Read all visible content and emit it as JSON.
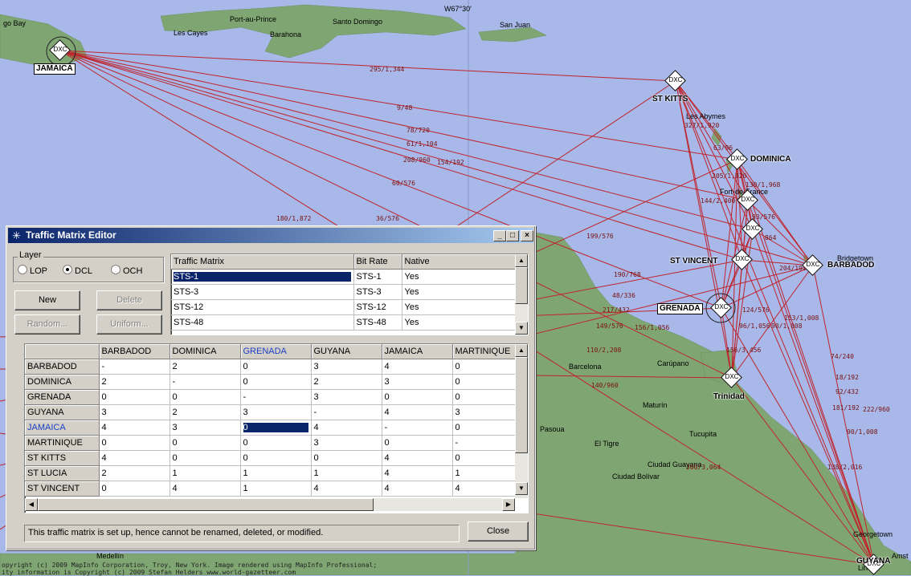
{
  "map": {
    "places": [
      "go Bay",
      "Port-au-Prince",
      "Les Cayes",
      "Barahona",
      "Santo Domingo",
      "San Juan",
      "W67°30'",
      "Les Abymes",
      "Fort-de-France",
      "Bridgetown",
      "Carúpano",
      "Barcelona",
      "Maturín",
      "Pasoua",
      "El Tigre",
      "Tucupita",
      "Ciudad Guayana",
      "Ciudad Bolívar",
      "Medellín",
      "Georgetown",
      "Linden",
      "Amst"
    ],
    "node_tag": "DXC",
    "nodes": [
      "JAMAICA",
      "ST KITTS",
      "DOMINICA",
      "ST VINCENT",
      "BARBADOD",
      "GRENADA",
      "Trinidad",
      "GUYANA"
    ],
    "traffic_labels": [
      "295/1,344",
      "9/48",
      "78/720",
      "61/1,104",
      "208/960",
      "154/192",
      "60/576",
      "180/1,872",
      "36/576",
      "199/576",
      "327/1,920",
      "63/96",
      "205/1,920",
      "130/1,968",
      "144/2,400",
      "864",
      "93/576",
      "190/768",
      "48/336",
      "217/432",
      "149/576",
      "156/1,056",
      "110/2,208",
      "124/576",
      "96/1,056",
      "156/3,456",
      "74/240",
      "18/192",
      "92/432",
      "181/192",
      "222/960",
      "90/1,008",
      "138/2,016",
      "140/960",
      "300/3,064",
      "90/1,008",
      "204/192",
      "153/1,008"
    ],
    "footer": [
      "opyright (c) 2009 MapInfo Corporation, Troy, New York. Image rendered using MapInfo Professional;",
      "ity information is Copyright (c) 2009 Stefan Helders www.world-gazetteer.com"
    ]
  },
  "window": {
    "title": "Traffic Matrix Editor",
    "controls": {
      "minimize": "_",
      "maximize": "□",
      "close": "×"
    },
    "layer": {
      "label": "Layer",
      "options": [
        "LOP",
        "DCL",
        "OCH"
      ],
      "selected": "DCL"
    },
    "buttons": {
      "new": "New",
      "delete": "Delete",
      "random": "Random...",
      "uniform": "Uniform...",
      "close": "Close"
    },
    "matrix_list": {
      "headers": [
        "Traffic Matrix",
        "Bit Rate",
        "Native"
      ],
      "rows": [
        [
          "STS-1",
          "STS-1",
          "Yes"
        ],
        [
          "STS-3",
          "STS-3",
          "Yes"
        ],
        [
          "STS-12",
          "STS-12",
          "Yes"
        ],
        [
          "STS-48",
          "STS-48",
          "Yes"
        ]
      ],
      "selected_index": 0
    },
    "grid": {
      "columns": [
        "BARBADOD",
        "DOMINICA",
        "GRENADA",
        "GUYANA",
        "JAMAICA",
        "MARTINIQUE"
      ],
      "highlight_column": "GRENADA",
      "rows": [
        {
          "name": "BARBADOD",
          "values": [
            "-",
            "2",
            "0",
            "3",
            "4",
            "0"
          ]
        },
        {
          "name": "DOMINICA",
          "values": [
            "2",
            "-",
            "0",
            "2",
            "3",
            "0"
          ]
        },
        {
          "name": "GRENADA",
          "values": [
            "0",
            "0",
            "-",
            "3",
            "0",
            "0"
          ]
        },
        {
          "name": "GUYANA",
          "values": [
            "3",
            "2",
            "3",
            "-",
            "4",
            "3"
          ]
        },
        {
          "name": "JAMAICA",
          "values": [
            "4",
            "3",
            "0",
            "4",
            "-",
            "0"
          ]
        },
        {
          "name": "MARTINIQUE",
          "values": [
            "0",
            "0",
            "0",
            "3",
            "0",
            "-"
          ]
        },
        {
          "name": "ST KITTS",
          "values": [
            "4",
            "0",
            "0",
            "0",
            "4",
            "0"
          ]
        },
        {
          "name": "ST LUCIA",
          "values": [
            "2",
            "1",
            "1",
            "1",
            "4",
            "1"
          ]
        },
        {
          "name": "ST VINCENT",
          "values": [
            "0",
            "4",
            "1",
            "4",
            "4",
            "4"
          ]
        }
      ],
      "highlight_row": "JAMAICA",
      "selected_cell": {
        "row": "JAMAICA",
        "col": "GRENADA"
      }
    },
    "status": "This traffic matrix is set up, hence cannot be renamed, deleted, or modified."
  },
  "colors": {
    "sea": "#a8b8e8",
    "land": "#7fa672",
    "link": "#c0242c",
    "title_start": "#0a246a",
    "title_end": "#a6caf0",
    "selection": "#0a246a",
    "highlight_text": "#1a3ec8"
  }
}
